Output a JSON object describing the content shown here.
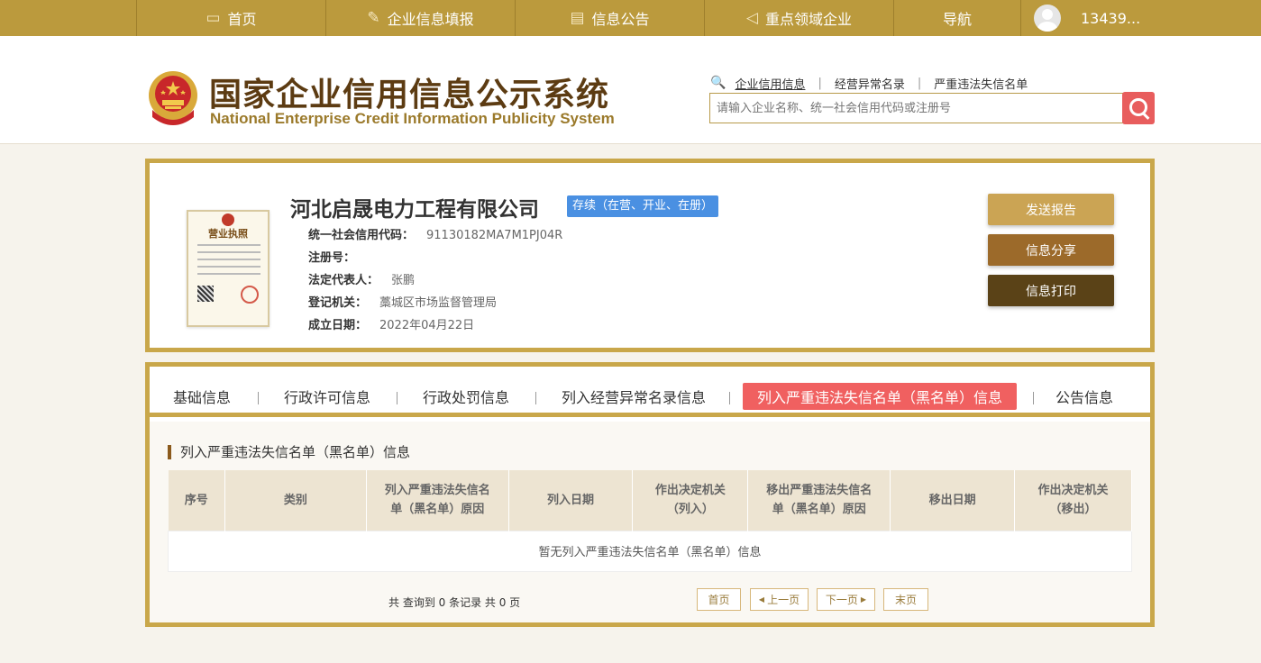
{
  "nav": {
    "items": [
      {
        "label": "首页",
        "icon": "monitor-icon"
      },
      {
        "label": "企业信息填报",
        "icon": "edit-icon"
      },
      {
        "label": "信息公告",
        "icon": "document-icon"
      },
      {
        "label": "重点领域企业",
        "icon": "speaker-icon"
      },
      {
        "label": "导航",
        "icon": ""
      }
    ],
    "user": "13439..."
  },
  "header": {
    "title": "国家企业信用信息公示系统",
    "subtitle": "National Enterprise Credit Information Publicity System",
    "search_links": [
      "企业信用信息",
      "经营异常名录",
      "严重违法失信名单"
    ],
    "search_placeholder": "请输入企业名称、统一社会信用代码或注册号"
  },
  "company": {
    "license_label": "营业执照",
    "name": "河北启晟电力工程有限公司",
    "status": "存续（在营、开业、在册）",
    "fields": [
      {
        "key": "统一社会信用代码：",
        "value": "91130182MA7M1PJ04R"
      },
      {
        "key": "注册号：",
        "value": ""
      },
      {
        "key": "法定代表人：",
        "value": "张鹏"
      },
      {
        "key": "登记机关：",
        "value": "藁城区市场监督管理局"
      },
      {
        "key": "成立日期：",
        "value": "2022年04月22日"
      }
    ],
    "buttons": {
      "send": "发送报告",
      "share": "信息分享",
      "print": "信息打印"
    }
  },
  "tabs": [
    {
      "label": "基础信息",
      "active": false
    },
    {
      "label": "行政许可信息",
      "active": false
    },
    {
      "label": "行政处罚信息",
      "active": false
    },
    {
      "label": "列入经营异常名录信息",
      "active": false
    },
    {
      "label": "列入严重违法失信名单（黑名单）信息",
      "active": true
    },
    {
      "label": "公告信息",
      "active": false
    }
  ],
  "section": {
    "title": "列入严重违法失信名单（黑名单）信息",
    "columns": [
      {
        "line1": "序号",
        "line2": ""
      },
      {
        "line1": "类别",
        "line2": ""
      },
      {
        "line1": "列入严重违法失信名",
        "line2": "单（黑名单）原因"
      },
      {
        "line1": "列入日期",
        "line2": ""
      },
      {
        "line1": "作出决定机关",
        "line2": "（列入）"
      },
      {
        "line1": "移出严重违法失信名",
        "line2": "单（黑名单）原因"
      },
      {
        "line1": "移出日期",
        "line2": ""
      },
      {
        "line1": "作出决定机关",
        "line2": "（移出）"
      }
    ],
    "empty_text": "暂无列入严重违法失信名单（黑名单）信息"
  },
  "pager": {
    "info": "共 查询到 0 条记录 共 0 页",
    "first": "首页",
    "prev": "上一页",
    "next": "下一页",
    "last": "末页"
  }
}
